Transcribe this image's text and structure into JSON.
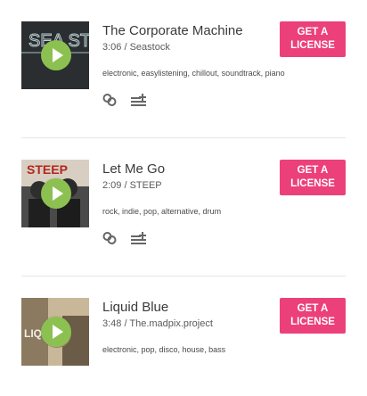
{
  "tracks": [
    {
      "title": "The Corporate Machine",
      "meta": "3:06 / Seastock",
      "tags": "electronic, easylistening, chillout, soundtrack, piano",
      "cover_text": "SEA STOCK",
      "license_line1": "GET A",
      "license_line2": "LICENSE"
    },
    {
      "title": "Let Me Go",
      "meta": "2:09 / STEEP",
      "tags": "rock, indie, pop, alternative, drum",
      "cover_text": "STEEP",
      "license_line1": "GET A",
      "license_line2": "LICENSE"
    },
    {
      "title": "Liquid Blue",
      "meta": "3:48 / The.madpix.project",
      "tags": "electronic, pop, disco, house, bass",
      "cover_text": "LIQ",
      "license_line1": "GET A",
      "license_line2": "LICENSE"
    }
  ],
  "colors": {
    "license_button": "#ec407a",
    "play_button": "#8cc152",
    "divider": "#e6e6e6"
  },
  "icons": [
    "play-icon",
    "link-icon",
    "add-to-playlist-icon"
  ]
}
